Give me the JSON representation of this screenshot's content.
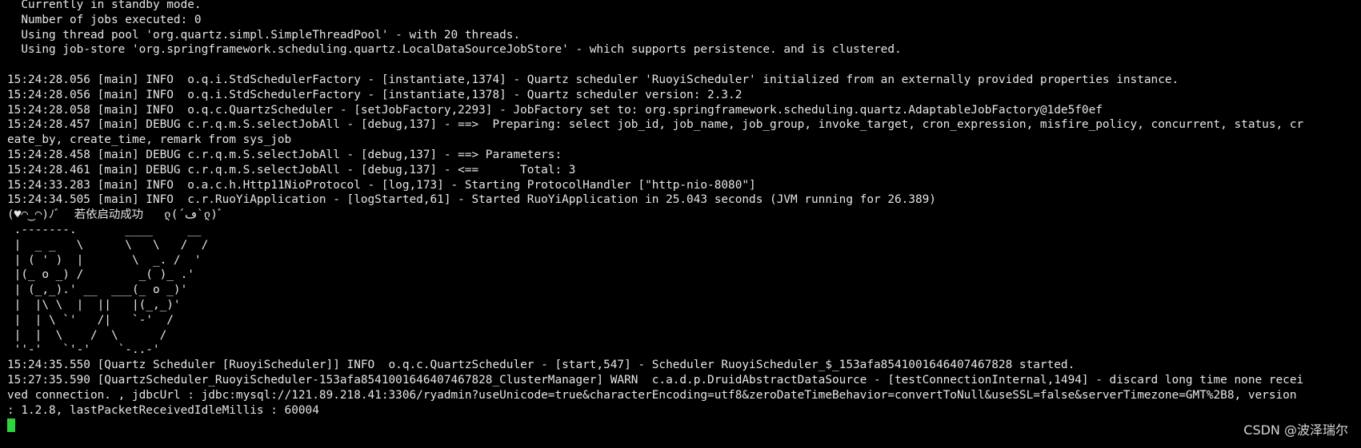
{
  "terminal": {
    "background": "#000000",
    "foreground": "#e6e6e6",
    "cursor_color": "#2fd33a",
    "lines": [
      "  Currently in standby mode.",
      "  Number of jobs executed: 0",
      "  Using thread pool 'org.quartz.simpl.SimpleThreadPool' - with 20 threads.",
      "  Using job-store 'org.springframework.scheduling.quartz.LocalDataSourceJobStore' - which supports persistence. and is clustered.",
      "",
      "15:24:28.056 [main] INFO  o.q.i.StdSchedulerFactory - [instantiate,1374] - Quartz scheduler 'RuoyiScheduler' initialized from an externally provided properties instance.",
      "15:24:28.056 [main] INFO  o.q.i.StdSchedulerFactory - [instantiate,1378] - Quartz scheduler version: 2.3.2",
      "15:24:28.058 [main] INFO  o.q.c.QuartzScheduler - [setJobFactory,2293] - JobFactory set to: org.springframework.scheduling.quartz.AdaptableJobFactory@1de5f0ef",
      "15:24:28.457 [main] DEBUG c.r.q.m.S.selectJobAll - [debug,137] - ==>  Preparing: select job_id, job_name, job_group, invoke_target, cron_expression, misfire_policy, concurrent, status, cr",
      "eate_by, create_time, remark from sys_job",
      "15:24:28.458 [main] DEBUG c.r.q.m.S.selectJobAll - [debug,137] - ==> Parameters:",
      "15:24:28.461 [main] DEBUG c.r.q.m.S.selectJobAll - [debug,137] - <==      Total: 3",
      "15:24:33.283 [main] INFO  o.a.c.h.Http11NioProtocol - [log,173] - Starting ProtocolHandler [\"http-nio-8080\"]",
      "15:24:34.505 [main] INFO  c.r.RuoYiApplication - [logStarted,61] - Started RuoYiApplication in 25.043 seconds (JVM running for 26.389)",
      "(♥◠‿◠)ﾉﾞ  若依启动成功   ლ(´ڡ`ლ)ﾞ"
    ],
    "ascii_art": [
      " .-------.       ____     __",
      " |  _ _   \\      \\   \\   /  /",
      " | ( ' )  |       \\  _. /  '",
      " |(_ o _) /        _( )_ .'",
      " | (_,_).' __  ___(_ o _)'",
      " |  |\\ \\  |  ||   |(_,_)'",
      " |  | \\ `'   /|   `-'  /",
      " |  |  \\    /  \\      /",
      " ''-'   `'-'    `-..-'"
    ],
    "lines_after": [
      "15:24:35.550 [Quartz Scheduler [RuoyiScheduler]] INFO  o.q.c.QuartzScheduler - [start,547] - Scheduler RuoyiScheduler_$_153afa8541001646407467828 started.",
      "15:27:35.590 [QuartzScheduler_RuoyiScheduler-153afa8541001646407467828_ClusterManager] WARN  c.a.d.p.DruidAbstractDataSource - [testConnectionInternal,1494] - discard long time none recei",
      "ved connection. , jdbcUrl : jdbc:mysql://121.89.218.41:3306/ryadmin?useUnicode=true&characterEncoding=utf8&zeroDateTimeBehavior=convertToNull&useSSL=false&serverTimezone=GMT%2B8, version",
      ": 1.2.8, lastPacketReceivedIdleMillis : 60004"
    ]
  },
  "watermark": {
    "text": "CSDN @波泽瑞尔"
  }
}
